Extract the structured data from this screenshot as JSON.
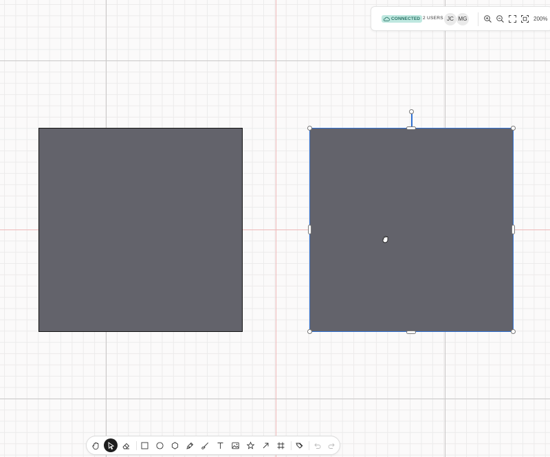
{
  "status_bar": {
    "connection_label": "CONNECTED",
    "users_label": "2 USERS",
    "avatars": [
      "JC",
      "MG"
    ],
    "zoom_label": "200%",
    "icons": [
      "cloud-icon",
      "zoom-in-icon",
      "zoom-out-icon",
      "fullscreen-icon",
      "fit-to-screen-icon"
    ]
  },
  "canvas": {
    "shapes": [
      {
        "name": "square",
        "fill": "#63636b",
        "selected": false
      },
      {
        "name": "square",
        "fill": "#63636b",
        "selected": true
      }
    ],
    "selection_color": "#2f6fd1",
    "cursor": "grab-hand-cursor"
  },
  "toolbar": {
    "tools": [
      "hand",
      "select",
      "eraser",
      "rectangle",
      "ellipse",
      "polygon",
      "pen",
      "brush",
      "text",
      "image",
      "star",
      "arrow",
      "frame",
      "link",
      "undo",
      "redo"
    ],
    "active_tool": "select"
  },
  "colors": {
    "accent": "#2f6fd1",
    "shape_fill": "#63636b",
    "badge_bg": "#bfe8e0",
    "badge_text": "#2b7466"
  }
}
